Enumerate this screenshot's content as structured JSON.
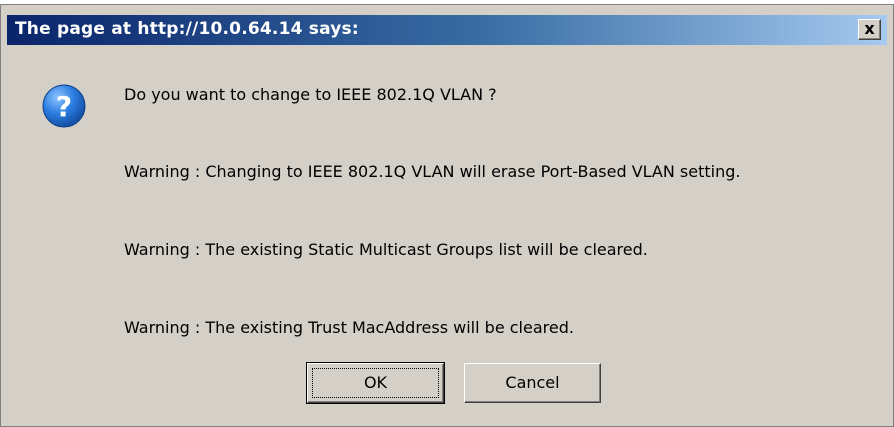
{
  "dialog": {
    "title": "The page at http://10.0.64.14 says:",
    "close_label": "x",
    "icon": "question-icon",
    "messages": [
      "Do you want to change to IEEE 802.1Q VLAN ?",
      "Warning : Changing to IEEE 802.1Q VLAN will erase Port-Based VLAN setting.",
      "Warning : The existing Static Multicast Groups list will be cleared.",
      "Warning : The existing Trust MacAddress will be cleared."
    ],
    "ok_label": "OK",
    "cancel_label": "Cancel"
  },
  "colors": {
    "titlebar_start": "#0a246a",
    "titlebar_end": "#a6caf0",
    "dialog_bg": "#d4d0c8",
    "icon_blue": "#1f6fd0"
  }
}
